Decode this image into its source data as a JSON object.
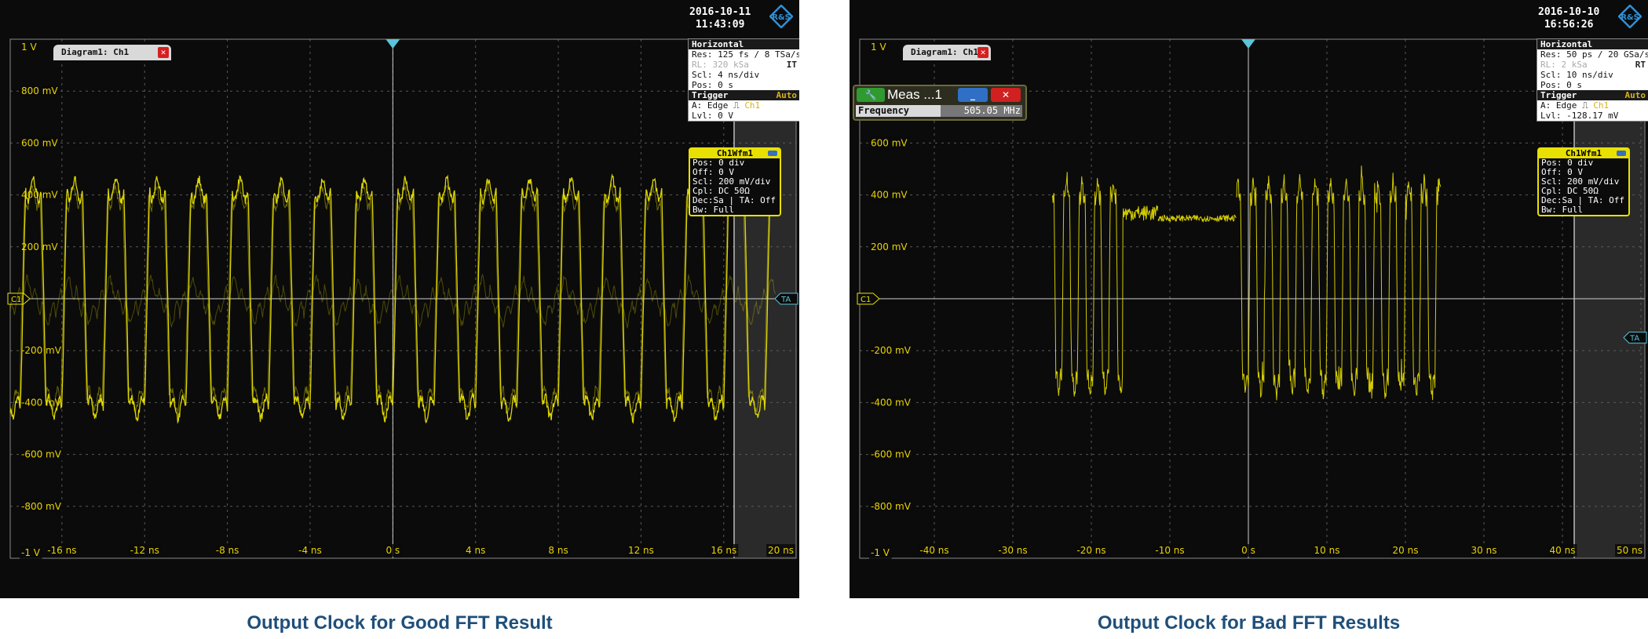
{
  "chart_data": [
    {
      "type": "line",
      "panel": "left",
      "diagram_tab": "Diagram1: Ch1",
      "timestamp": {
        "date": "2016-10-11",
        "time": "11:43:09"
      },
      "xlim": [
        -18.5,
        19.5
      ],
      "ylim": [
        -1000,
        1000
      ],
      "y_ticks": [
        {
          "v": 1000,
          "label": "1 V"
        },
        {
          "v": 800,
          "label": "800 mV"
        },
        {
          "v": 600,
          "label": "600 mV"
        },
        {
          "v": 400,
          "label": "400 mV"
        },
        {
          "v": 200,
          "label": "200 mV"
        },
        {
          "v": -200,
          "label": "-200 mV"
        },
        {
          "v": -400,
          "label": "-400 mV"
        },
        {
          "v": -600,
          "label": "-600 mV"
        },
        {
          "v": -800,
          "label": "-800 mV"
        },
        {
          "v": -1000,
          "label": "-1 V"
        }
      ],
      "x_ticks": [
        {
          "v": -16,
          "label": "-16 ns"
        },
        {
          "v": -12,
          "label": "-12 ns"
        },
        {
          "v": -8,
          "label": "-8 ns"
        },
        {
          "v": -4,
          "label": "-4 ns"
        },
        {
          "v": 0,
          "label": "0 s"
        },
        {
          "v": 4,
          "label": "4 ns"
        },
        {
          "v": 8,
          "label": "8 ns"
        },
        {
          "v": 12,
          "label": "12 ns"
        },
        {
          "v": 16,
          "label": "16 ns"
        },
        {
          "v": 20,
          "label": "20 ns"
        }
      ],
      "shaded_from": 16.5,
      "signal": {
        "kind": "clock",
        "period_ns": 2.0,
        "high_mV": 420,
        "low_mV": -420,
        "noise_mV": 35,
        "x_start": -18.5,
        "x_end": 18.5
      },
      "ghost_signal": {
        "kind": "clock",
        "period_ns": 2.0,
        "high_mV": 40,
        "low_mV": -60,
        "x_start": -18.5,
        "x_end": 18.5
      },
      "ch_marker": "C1",
      "ta_marker": "TA",
      "horizontal": {
        "title": "Horizontal",
        "res": "Res: 125 fs / 8 TSa/s",
        "rl": "RL:  320 kSa",
        "rl_flag": "IT",
        "scl": "Scl: 4 ns/div",
        "pos": "Pos: 0 s"
      },
      "trigger": {
        "title": "Trigger",
        "mode": "Auto",
        "a": "A:  Edge",
        "a_src": "Ch1",
        "lvl": "Lvl: 0 V"
      },
      "wfm": {
        "title": "Ch1Wfm1",
        "rows": [
          "Pos: 0 div",
          "Off: 0 V",
          "Scl: 200 mV/div",
          "Cpl: DC 50Ω",
          "Dec:Sa | TA: Off",
          "Bw: Full"
        ]
      },
      "caption": "Output Clock for Good FFT Result"
    },
    {
      "type": "line",
      "panel": "right",
      "diagram_tab": "Diagram1: Ch1",
      "timestamp": {
        "date": "2016-10-10",
        "time": "16:56:26"
      },
      "xlim": [
        -49.5,
        50.5
      ],
      "ylim": [
        -1000,
        1000
      ],
      "y_ticks": [
        {
          "v": 1000,
          "label": "1 V"
        },
        {
          "v": 600,
          "label": "600 mV"
        },
        {
          "v": 400,
          "label": "400 mV"
        },
        {
          "v": 200,
          "label": "200 mV"
        },
        {
          "v": -200,
          "label": "-200 mV"
        },
        {
          "v": -400,
          "label": "-400 mV"
        },
        {
          "v": -600,
          "label": "-600 mV"
        },
        {
          "v": -800,
          "label": "-800 mV"
        },
        {
          "v": -1000,
          "label": "-1 V"
        }
      ],
      "x_ticks": [
        {
          "v": -40,
          "label": "-40 ns"
        },
        {
          "v": -30,
          "label": "-30 ns"
        },
        {
          "v": -20,
          "label": "-20 ns"
        },
        {
          "v": -10,
          "label": "-10 ns"
        },
        {
          "v": 0,
          "label": "0 s"
        },
        {
          "v": 10,
          "label": "10 ns"
        },
        {
          "v": 20,
          "label": "20 ns"
        },
        {
          "v": 30,
          "label": "30 ns"
        },
        {
          "v": 40,
          "label": "40 ns"
        },
        {
          "v": 50,
          "label": "50 ns"
        }
      ],
      "shaded_from": 41.5,
      "signal": {
        "kind": "burst",
        "segments": [
          [
            -25,
            -17,
            "clock"
          ],
          [
            -17,
            -11.5,
            "flat_high"
          ],
          [
            -11.5,
            -1.5,
            "flat_top"
          ],
          [
            -1.5,
            24.5,
            "clock"
          ]
        ],
        "period_ns": 1.98,
        "high_mV": 420,
        "low_mV": -330,
        "noise_mV": 55,
        "x_start": -25,
        "x_end": 24.5
      },
      "ch_marker": "C1",
      "ta_marker": "TA",
      "measure": {
        "title": "Meas ...1",
        "label": "Frequency",
        "value": "505.05 MHz"
      },
      "horizontal": {
        "title": "Horizontal",
        "res": "Res: 50 ps / 20 GSa/s",
        "rl": "RL:  2 kSa",
        "rl_flag": "RT",
        "scl": "Scl: 10 ns/div",
        "pos": "Pos: 0 s"
      },
      "trigger": {
        "title": "Trigger",
        "mode": "Auto",
        "a": "A:  Edge",
        "a_src": "Ch1",
        "lvl": "Lvl: -128.17 mV"
      },
      "wfm": {
        "title": "Ch1Wfm1",
        "rows": [
          "Pos: 0 div",
          "Off: 0 V",
          "Scl: 200 mV/div",
          "Cpl: DC 50Ω",
          "Dec:Sa | TA: Off",
          "Bw: Full"
        ]
      },
      "caption": "Output Clock for Bad FFT Results"
    }
  ],
  "colors": {
    "trace": "#e8e000",
    "grid": "#5a5a5a",
    "axis": "#cfcfcf",
    "label": "#e8d300",
    "background": "#0b0b0b",
    "caption": "#1f4f7a",
    "marker": "#59c5d8"
  }
}
